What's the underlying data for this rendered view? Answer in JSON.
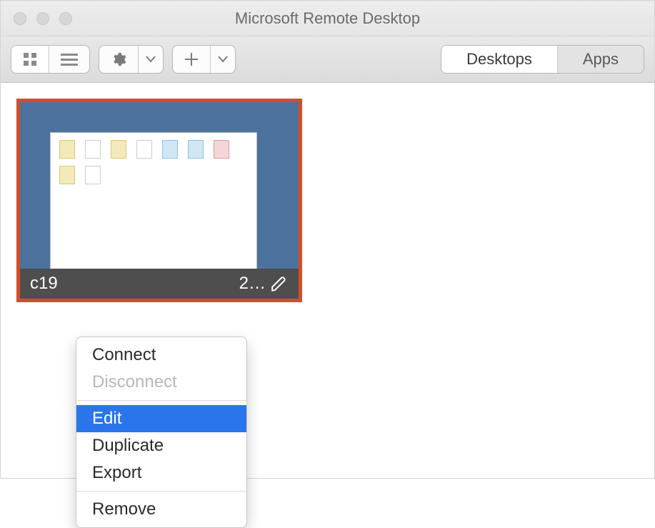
{
  "window": {
    "title": "Microsoft Remote Desktop"
  },
  "toolbar": {
    "tabs": {
      "desktops": "Desktops",
      "apps": "Apps",
      "selected": "desktops"
    }
  },
  "desktop_tile": {
    "name_left": "c19",
    "name_right": "2…",
    "selected": true,
    "border_color": "#d24e27"
  },
  "context_menu": {
    "items": [
      {
        "key": "connect",
        "label": "Connect",
        "enabled": true,
        "highlight": false
      },
      {
        "key": "disconnect",
        "label": "Disconnect",
        "enabled": false,
        "highlight": false
      },
      {
        "sep": true
      },
      {
        "key": "edit",
        "label": "Edit",
        "enabled": true,
        "highlight": true
      },
      {
        "key": "duplicate",
        "label": "Duplicate",
        "enabled": true,
        "highlight": false
      },
      {
        "key": "export",
        "label": "Export",
        "enabled": true,
        "highlight": false
      },
      {
        "sep": true
      },
      {
        "key": "remove",
        "label": "Remove",
        "enabled": true,
        "highlight": false
      }
    ]
  },
  "colors": {
    "highlight": "#2a75ea",
    "thumb_bg": "#4b739e"
  }
}
